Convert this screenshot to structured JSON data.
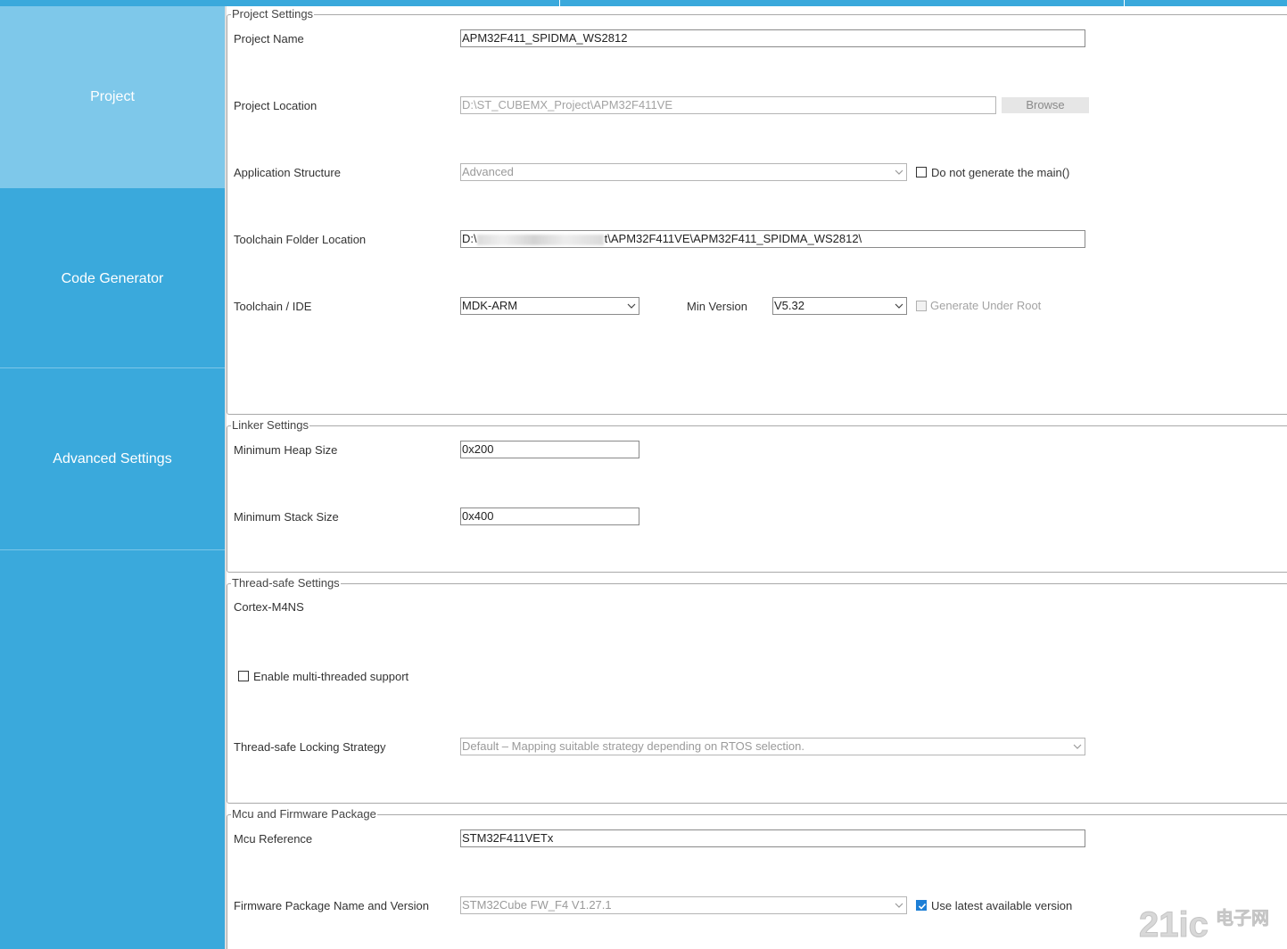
{
  "sidebar": {
    "items": [
      {
        "label": "Project",
        "active": true
      },
      {
        "label": "Code Generator",
        "active": false
      },
      {
        "label": "Advanced Settings",
        "active": false
      }
    ]
  },
  "project_settings": {
    "title": "Project Settings",
    "project_name": {
      "label": "Project Name",
      "value": "APM32F411_SPIDMA_WS2812"
    },
    "project_location": {
      "label": "Project Location",
      "value": "D:\\ST_CUBEMX_Project\\APM32F411VE",
      "browse_label": "Browse"
    },
    "application_structure": {
      "label": "Application Structure",
      "value": "Advanced",
      "checkbox_label": "Do not generate the main()",
      "checkbox_checked": false
    },
    "toolchain_folder": {
      "label": "Toolchain Folder Location",
      "prefix": "D:\\",
      "value_visible": "t\\APM32F411VE\\APM32F411_SPIDMA_WS2812\\"
    },
    "toolchain_ide": {
      "label": "Toolchain / IDE",
      "value": "MDK-ARM",
      "min_version_label": "Min Version",
      "min_version_value": "V5.32",
      "generate_under_root_label": "Generate Under Root",
      "generate_under_root_checked": false
    }
  },
  "linker_settings": {
    "title": "Linker Settings",
    "min_heap": {
      "label": "Minimum Heap Size",
      "value": "0x200"
    },
    "min_stack": {
      "label": "Minimum Stack Size",
      "value": "0x400"
    }
  },
  "thread_safe_settings": {
    "title": "Thread-safe Settings",
    "core": "Cortex-M4NS",
    "multi_thread_label": "Enable multi-threaded support",
    "multi_thread_checked": false,
    "locking_strategy": {
      "label": "Thread-safe Locking Strategy",
      "value": "Default  –  Mapping suitable strategy depending on RTOS selection."
    }
  },
  "mcu_firmware": {
    "title": "Mcu and Firmware Package",
    "mcu_reference": {
      "label": "Mcu Reference",
      "value": "STM32F411VETx"
    },
    "firmware_package": {
      "label": "Firmware Package Name and Version",
      "value": "STM32Cube FW_F4 V1.27.1",
      "use_latest_label": "Use latest available version",
      "use_latest_checked": true
    }
  },
  "watermark": {
    "text": "21ic电子网"
  },
  "colors": {
    "sidebar": "#3aa9dc",
    "sidebar_active": "#7ec8ea",
    "checkbox_checked": "#1d7fd6"
  }
}
